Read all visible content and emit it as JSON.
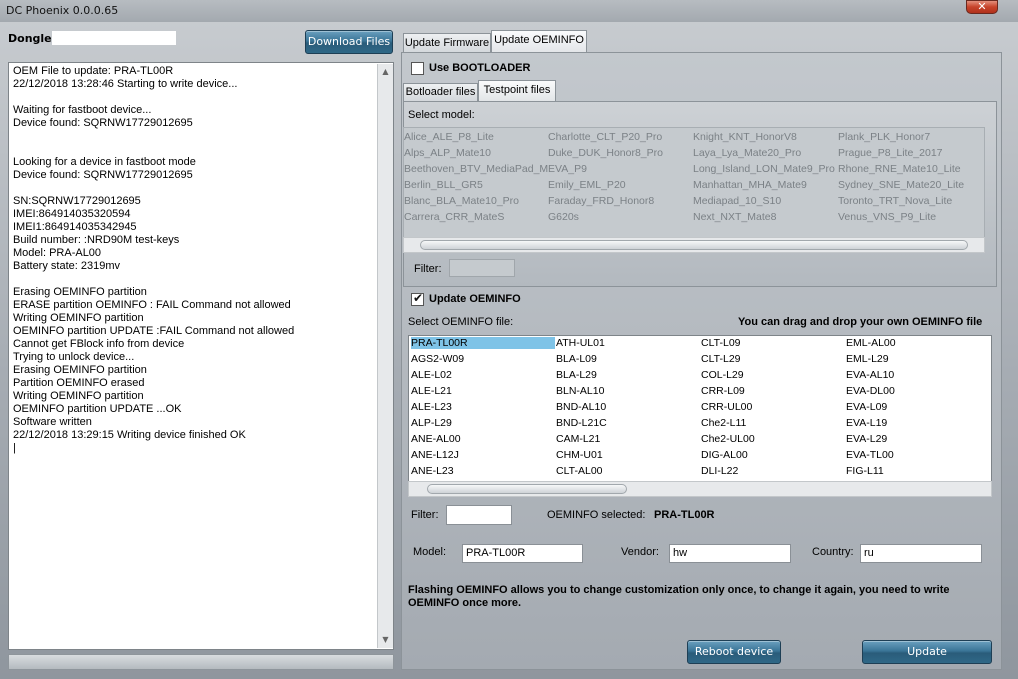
{
  "window": {
    "title": "DC Phoenix 0.0.0.65",
    "close_icon": "close-icon"
  },
  "dongle": {
    "label": "Dongle:"
  },
  "download_button": "Download Files",
  "log": {
    "lines": "OEM File to update: PRA-TL00R\n22/12/2018 13:28:46 Starting to write device...\n\nWaiting for fastboot device...\nDevice found: SQRNW17729012695\n\n\nLooking for a device in fastboot mode\nDevice found: SQRNW17729012695\n\nSN:SQRNW17729012695\nIMEI:864914035320594\nIMEI1:864914035342945\nBuild number: :NRD90M test-keys\nModel: PRA-AL00\nBattery state: 2319mv\n\nErasing OEMINFO partition\nERASE partition OEMINFO : FAIL Command not allowed\nWriting OEMINFO partition\nOEMINFO partition UPDATE :FAIL Command not allowed\nCannot get FBlock info from device\nTrying to unlock device...\nErasing OEMINFO partition\nPartition OEMINFO erased\nWriting OEMINFO partition\nOEMINFO partition UPDATE ...OK\nSoftware written\n22/12/2018 13:29:15 Writing device finished OK\n|"
  },
  "tabs": {
    "update_firmware": "Update Firmware",
    "update_oeminfo": "Update OEMINFO"
  },
  "use_bootloader": {
    "label": "Use BOOTLOADER",
    "checked": false
  },
  "subtabs": {
    "bootloader_files": "Botloader files",
    "testpoint_files": "Testpoint files"
  },
  "select_model_label": "Select model:",
  "models": [
    [
      "Alice_ALE_P8_Lite",
      "Alps_ALP_Mate10",
      "Beethoven_BTV_MediaPad_M",
      "Berlin_BLL_GR5",
      "Blanc_BLA_Mate10_Pro",
      "Carrera_CRR_MateS"
    ],
    [
      "Charlotte_CLT_P20_Pro",
      "Duke_DUK_Honor8_Pro",
      "EVA_P9",
      "Emily_EML_P20",
      "Faraday_FRD_Honor8",
      "G620s"
    ],
    [
      "Knight_KNT_HonorV8",
      "Laya_Lya_Mate20_Pro",
      "Long_Island_LON_Mate9_Pro",
      "Manhattan_MHA_Mate9",
      "Mediapad_10_S10",
      "Next_NXT_Mate8"
    ],
    [
      "Plank_PLK_Honor7",
      "Prague_P8_Lite_2017",
      "Rhone_RNE_Mate10_Lite",
      "Sydney_SNE_Mate20_Lite",
      "Toronto_TRT_Nova_Lite",
      "Venus_VNS_P9_Lite"
    ]
  ],
  "filter_label": "Filter:",
  "update_oeminfo": {
    "label": "Update OEMINFO",
    "checked": true
  },
  "select_oeminfo_label": "Select OEMINFO file:",
  "drag_drop_hint": "You can drag and drop your own OEMINFO file",
  "oeminfo_files": [
    [
      "PRA-TL00R",
      "AGS2-W09",
      "ALE-L02",
      "ALE-L21",
      "ALE-L23",
      "ALP-L29",
      "ANE-AL00",
      "ANE-L12J",
      "ANE-L23"
    ],
    [
      "ATH-UL01",
      "BLA-L09",
      "BLA-L29",
      "BLN-AL10",
      "BND-AL10",
      "BND-L21C",
      "CAM-L21",
      "CHM-U01",
      "CLT-AL00"
    ],
    [
      "CLT-L09",
      "CLT-L29",
      "COL-L29",
      "CRR-L09",
      "CRR-UL00",
      "Che2-L11",
      "Che2-UL00",
      "DIG-AL00",
      "DLI-L22"
    ],
    [
      "EML-AL00",
      "EML-L29",
      "EVA-AL10",
      "EVA-DL00",
      "EVA-L09",
      "EVA-L19",
      "EVA-L29",
      "EVA-TL00",
      "FIG-L11"
    ]
  ],
  "selected_oeminfo": "PRA-TL00R",
  "oeminfo_selected_label": "OEMINFO selected:",
  "oeminfo_selected_value": "PRA-TL00R",
  "model": {
    "label": "Model:",
    "value": "PRA-TL00R"
  },
  "vendor": {
    "label": "Vendor:",
    "value": "hw"
  },
  "country": {
    "label": "Country:",
    "value": "ru"
  },
  "warning": "Flashing OEMINFO allows you to change customization only once, to change it again, you need to write OEMINFO once more.",
  "reboot_button": "Reboot device",
  "update_button": "Update"
}
